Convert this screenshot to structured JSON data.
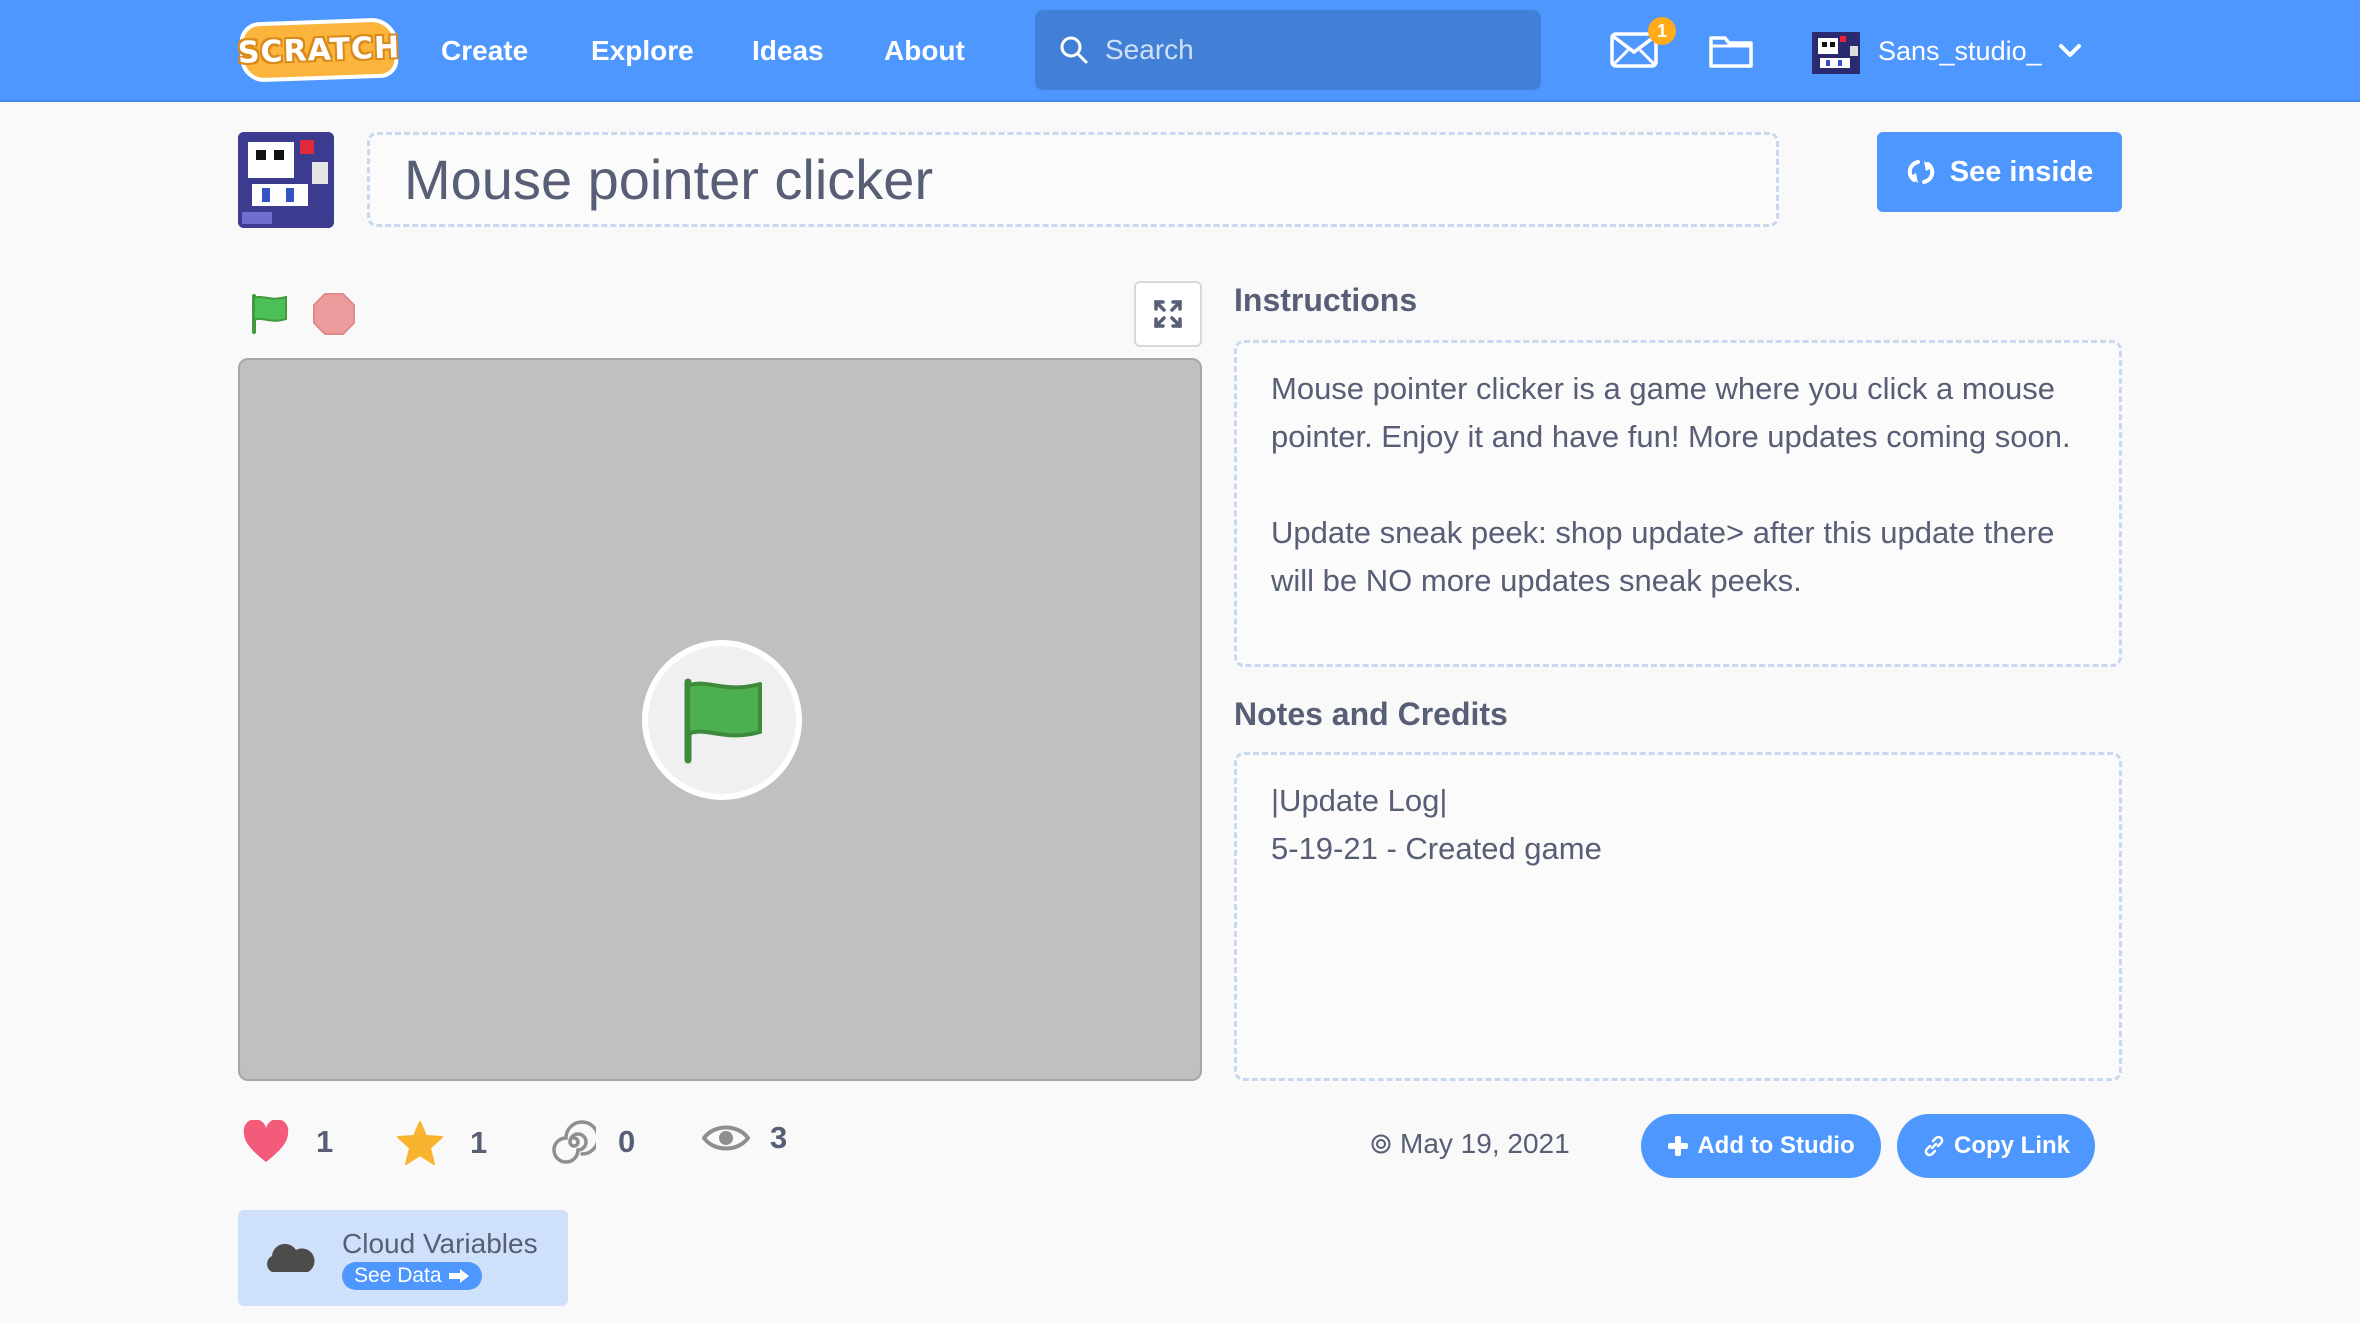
{
  "nav": {
    "logo_text": "SCRATCH",
    "links": [
      "Create",
      "Explore",
      "Ideas",
      "About"
    ],
    "search_placeholder": "Search",
    "messages_count": "1",
    "username": "Sans_studio_"
  },
  "project": {
    "title": "Mouse pointer clicker",
    "see_inside_label": "See inside"
  },
  "stats": {
    "loves": "1",
    "favorites": "1",
    "remixes": "0",
    "views": "3"
  },
  "cloud": {
    "title": "Cloud Variables",
    "link_label": "See Data"
  },
  "instructions": {
    "heading": "Instructions",
    "paragraphs": [
      "Mouse pointer clicker is a game where you click a mouse pointer. Enjoy it and have fun! More updates coming soon.",
      "Update sneak peek: shop update> after this update there will be NO more updates sneak peeks."
    ]
  },
  "notes": {
    "heading": "Notes and Credits",
    "lines": [
      "|Update Log|",
      "5-19-21 - Created game"
    ]
  },
  "footer": {
    "date": "May 19, 2021",
    "add_to_studio_label": "Add to Studio",
    "copy_link_label": "Copy Link"
  },
  "colors": {
    "brand_blue": "#4d97ff",
    "flag_green": "#4cae4c",
    "stop_red": "#ec9c9c",
    "heart": "#f25b79",
    "star": "#f9b42f"
  }
}
